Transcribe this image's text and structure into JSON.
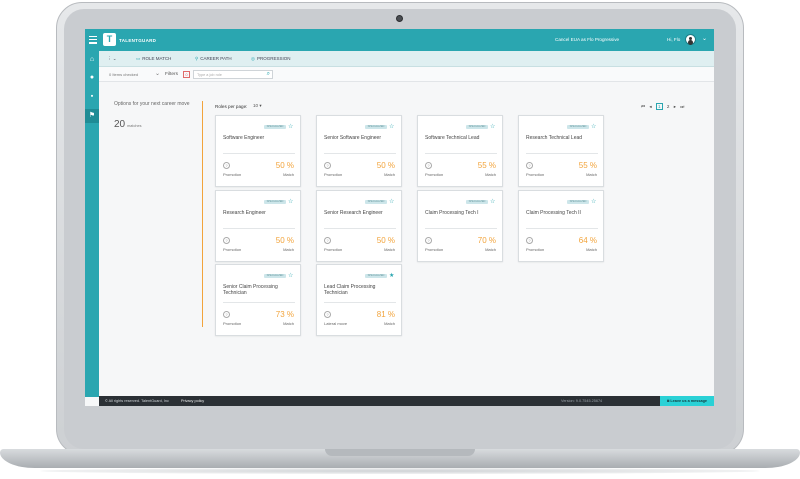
{
  "topbar": {
    "logo_text": "TALENTGUARD",
    "cancel_link": "Cancel EUA as Flo Progressive",
    "greeting": "Hi, Flo"
  },
  "tabs": [
    {
      "label": "ROLE MATCH",
      "icon": "role-match-icon"
    },
    {
      "label": "CAREER PATH",
      "icon": "map-pin-icon"
    },
    {
      "label": "PROGRESSION",
      "icon": "progression-icon"
    }
  ],
  "toolbar": {
    "items_checked": "0 Items checked",
    "filters_label": "Filters",
    "filters_count": "0",
    "search_placeholder": "Type a job role"
  },
  "summary": {
    "title": "Options for your next career move",
    "count": "20",
    "count_label": "matches"
  },
  "paging": {
    "roles_per_page_label": "Roles per page:",
    "roles_per_page_value": "10",
    "pages": [
      "1",
      "2"
    ],
    "current_page": "1"
  },
  "cards": [
    {
      "title": "Software Engineer",
      "match": "50 %",
      "move": "Promotion",
      "match_label": "Match",
      "tag": "SPECIALIZED",
      "starred": false
    },
    {
      "title": "Senior Software Engineer",
      "match": "50 %",
      "move": "Promotion",
      "match_label": "Match",
      "tag": "SPECIALIZED",
      "starred": false
    },
    {
      "title": "Software Technical Lead",
      "match": "55 %",
      "move": "Promotion",
      "match_label": "Match",
      "tag": "SPECIALIZED",
      "starred": false
    },
    {
      "title": "Research Technical Lead",
      "match": "55 %",
      "move": "Promotion",
      "match_label": "Match",
      "tag": "SPECIALIZED",
      "starred": false
    },
    {
      "title": "Research Engineer",
      "match": "50 %",
      "move": "Promotion",
      "match_label": "Match",
      "tag": "SPECIALIZED",
      "starred": false
    },
    {
      "title": "Senior Research Engineer",
      "match": "50 %",
      "move": "Promotion",
      "match_label": "Match",
      "tag": "SPECIALIZED",
      "starred": false
    },
    {
      "title": "Claim Processing Tech I",
      "match": "70 %",
      "move": "Promotion",
      "match_label": "Match",
      "tag": "SPECIALIZED",
      "starred": false
    },
    {
      "title": "Claim Processing Tech II",
      "match": "64 %",
      "move": "Promotion",
      "match_label": "Match",
      "tag": "SPECIALIZED",
      "starred": false
    },
    {
      "title": "Senior Claim Processing Technician",
      "match": "73 %",
      "move": "Promotion",
      "match_label": "Match",
      "tag": "SPECIALIZED",
      "starred": false
    },
    {
      "title": "Lead Claim Processing Technician",
      "match": "81 %",
      "move": "Lateral move",
      "match_label": "Match",
      "tag": "SPECIALIZED",
      "starred": true
    }
  ],
  "footer": {
    "copyright": "© All rights reserved. TalentGuard, Inc",
    "privacy": "Privacy policy",
    "version": "Version: 9.0.7545.25674",
    "leave_message": "Leave us a message"
  },
  "colors": {
    "accent": "#2aa6b0",
    "match": "#f2a43c",
    "footer": "#2b3035"
  }
}
